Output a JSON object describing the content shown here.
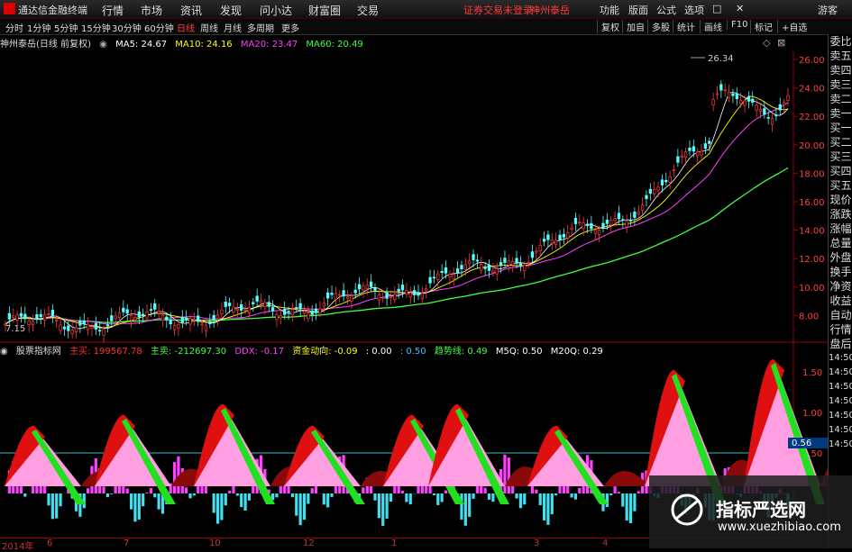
{
  "titlebar": {
    "app_name": "通达信金融终端",
    "menus": [
      "行情",
      "市场",
      "资讯",
      "发现",
      "问小达",
      "财富圈",
      "交易"
    ],
    "warning": "证券交易未登录",
    "stock": "神州泰岳",
    "right_buttons": [
      "功能",
      "版面",
      "公式",
      "选项",
      "游客"
    ]
  },
  "toolbar": {
    "periods": [
      "分时",
      "1分钟",
      "5分钟",
      "15分钟",
      "30分钟",
      "60分钟",
      "日线",
      "周线",
      "月线",
      "多周期",
      "更多"
    ],
    "active_period": "日线",
    "right_buttons": [
      "复权",
      "加自",
      "多股",
      "统计",
      "画线",
      "F10",
      "标记",
      "+自选"
    ]
  },
  "main_chart": {
    "title": "神州泰岳(日线 前复权)",
    "ma": [
      {
        "label": "MA5: 24.67",
        "color": "#ffffff"
      },
      {
        "label": "MA10: 24.16",
        "color": "#ffff00"
      },
      {
        "label": "MA20: 23.47",
        "color": "#ff40ff"
      },
      {
        "label": "MA60: 20.49",
        "color": "#40ff40"
      }
    ],
    "high_label": "26.34",
    "low_label": "7.15",
    "y_ticks": [
      "26.00",
      "24.00",
      "22.00",
      "20.00",
      "18.00",
      "16.00",
      "14.00",
      "12.00",
      "10.00",
      "8.00"
    ]
  },
  "sub_chart": {
    "title": "股票指标网",
    "items": [
      {
        "label": "主买: 199567.78",
        "color": "#ff3030"
      },
      {
        "label": "主卖: -212697.30",
        "color": "#40ff40"
      },
      {
        "label": "DDX: -0.17",
        "color": "#ff40ff"
      },
      {
        "label": "资金动向: -0.09",
        "color": "#ffff00"
      },
      {
        "label": ": 0.00",
        "color": "#ffffff"
      },
      {
        "label": ": 0.50",
        "color": "#40c0ff"
      },
      {
        "label": "趋势线: 0.49",
        "color": "#40ff40"
      },
      {
        "label": "M5Q: 0.50",
        "color": "#ffffff"
      },
      {
        "label": "M20Q: 0.29",
        "color": "#ffffff"
      }
    ],
    "y_ticks": [
      "1.50",
      "1.00",
      "0.50"
    ],
    "current_value": "0.56"
  },
  "right_panel": [
    "委比",
    "卖五",
    "卖四",
    "卖三",
    "卖二",
    "卖一",
    "买一",
    "买二",
    "买三",
    "买四",
    "买五",
    "现价",
    "涨跌",
    "涨幅",
    "总量",
    "外盘",
    "换手",
    "净资",
    "收益",
    "自动",
    "行情",
    "盘后",
    "14:50",
    "14:50",
    "14:50",
    "14:50",
    "14:50",
    "14:50",
    "14:50"
  ],
  "x_axis": [
    "2014年",
    "6",
    "7",
    "10",
    "12",
    "1",
    "3",
    "4"
  ],
  "watermark": {
    "title": "指标严选网",
    "url": "www.xuezhibiao.com"
  }
}
